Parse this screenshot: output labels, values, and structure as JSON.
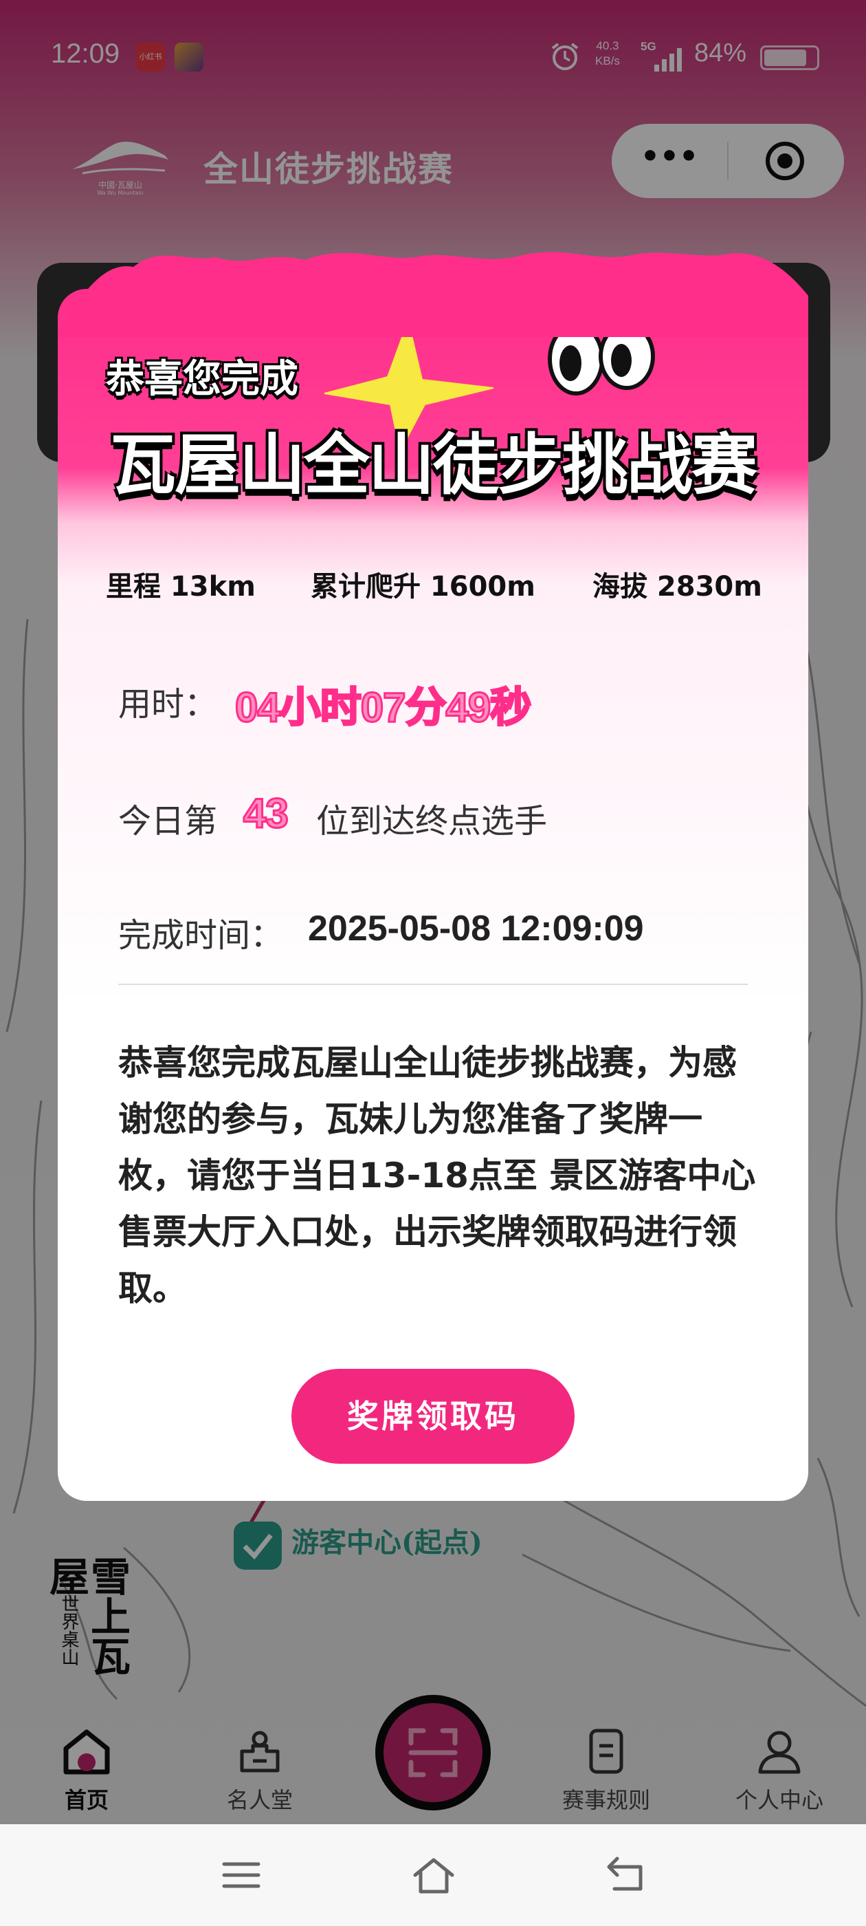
{
  "status_bar": {
    "time": "12:09",
    "app_badge": "小红书",
    "net_speed_value": "40.3",
    "net_speed_unit": "KB/s",
    "network": "5G",
    "battery": "84%",
    "battery_level": 0.84
  },
  "header": {
    "logo_top": "中國·瓦屋山",
    "logo_bottom": "Wa Wu Mountain",
    "title": "全山徒步挑战赛",
    "more_icon": "more-dots-icon",
    "close_icon": "target-close-icon"
  },
  "modal": {
    "congrats": "恭喜您完成",
    "race_title": "瓦屋山全山徒步挑战赛",
    "stats": {
      "distance": "里程 13km",
      "climb": "累计爬升 1600m",
      "altitude": "海拔 2830m"
    },
    "time_label": "用时：",
    "time_value": "04小时07分49秒",
    "rank_prefix": "今日第",
    "rank_value": "43",
    "rank_suffix": "位到达终点选手",
    "finish_label": "完成时间：",
    "finish_value": "2025-05-08 12:09:09",
    "message": "恭喜您完成瓦屋山全山徒步挑战赛，为感谢您的参与，瓦妹儿为您准备了奖牌一枚，请您于当日13-18点至 景区游客中心售票大厅入口处，出示奖牌领取码进行领取。",
    "button": "奖牌领取码",
    "accent": "#f2287f"
  },
  "map": {
    "checkpoint": "游客中心(起点)",
    "checkpoint_color": "#2c9c8a"
  },
  "brand": {
    "big": "雪上瓦屋",
    "small": "世界桌山"
  },
  "tabbar": {
    "items": [
      {
        "label": "首页",
        "icon": "home-icon"
      },
      {
        "label": "名人堂",
        "icon": "podium-icon"
      },
      {
        "label": "赛事规则",
        "icon": "document-icon"
      },
      {
        "label": "个人中心",
        "icon": "person-icon"
      }
    ],
    "center_icon": "scan-icon"
  },
  "system_nav": [
    "menu-icon",
    "home-outline-icon",
    "back-icon"
  ]
}
